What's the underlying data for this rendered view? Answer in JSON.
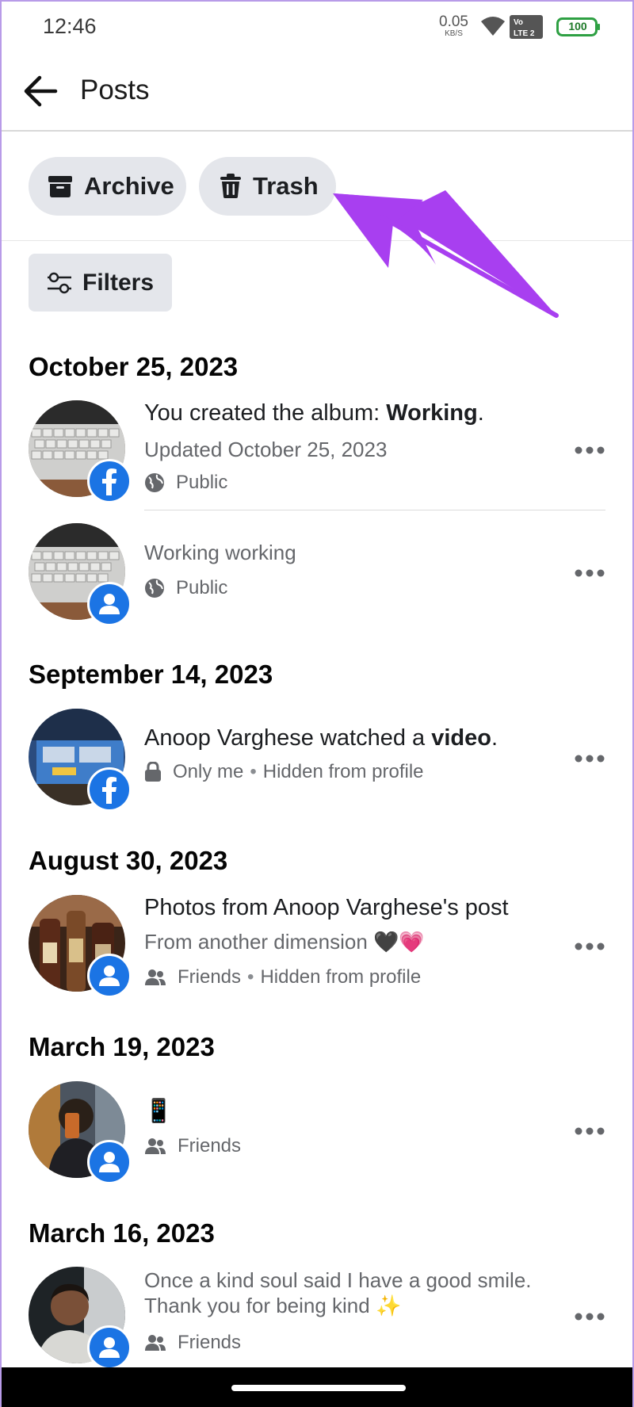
{
  "status_bar": {
    "time": "12:46",
    "net_speed": "0.05",
    "net_unit": "KB/S",
    "volte_top": "Vo",
    "volte_bottom": "LTE 2",
    "battery": "100"
  },
  "header": {
    "title": "Posts"
  },
  "tabs": {
    "archive": "Archive",
    "trash": "Trash"
  },
  "filters_label": "Filters",
  "groups": [
    {
      "date": "October 25, 2023",
      "posts": [
        {
          "title_prefix": "You created the album: ",
          "title_bold": "Working",
          "title_suffix": ".",
          "subtitle": "Updated October 25, 2023",
          "privacy": "Public"
        },
        {
          "subtitle": "Working working",
          "privacy": "Public"
        }
      ]
    },
    {
      "date": "September 14, 2023",
      "posts": [
        {
          "title_prefix": "Anoop Varghese watched a ",
          "title_bold": "video",
          "title_suffix": ".",
          "privacy": "Only me",
          "extra": "Hidden from profile"
        }
      ]
    },
    {
      "date": "August 30, 2023",
      "posts": [
        {
          "title": "Photos from Anoop Varghese's post",
          "subtitle": "From another dimension 🖤💗",
          "privacy": "Friends",
          "extra": "Hidden from profile"
        }
      ]
    },
    {
      "date": "March 19, 2023",
      "posts": [
        {
          "title": "📱",
          "privacy": "Friends"
        }
      ]
    },
    {
      "date": "March 16, 2023",
      "posts": [
        {
          "subtitle_line1": "Once a kind soul said I have a good smile.",
          "subtitle_line2": "Thank you for being kind ✨",
          "privacy": "Friends"
        }
      ]
    }
  ],
  "colors": {
    "facebook_blue": "#1b74e4",
    "annotation_arrow": "#a83ff0",
    "chip_bg": "#e4e6eb"
  },
  "icons": [
    "back-arrow-icon",
    "archive-icon",
    "trash-icon",
    "filters-icon",
    "globe-icon",
    "lock-icon",
    "friends-icon",
    "facebook-icon",
    "profile-icon",
    "more-icon"
  ]
}
